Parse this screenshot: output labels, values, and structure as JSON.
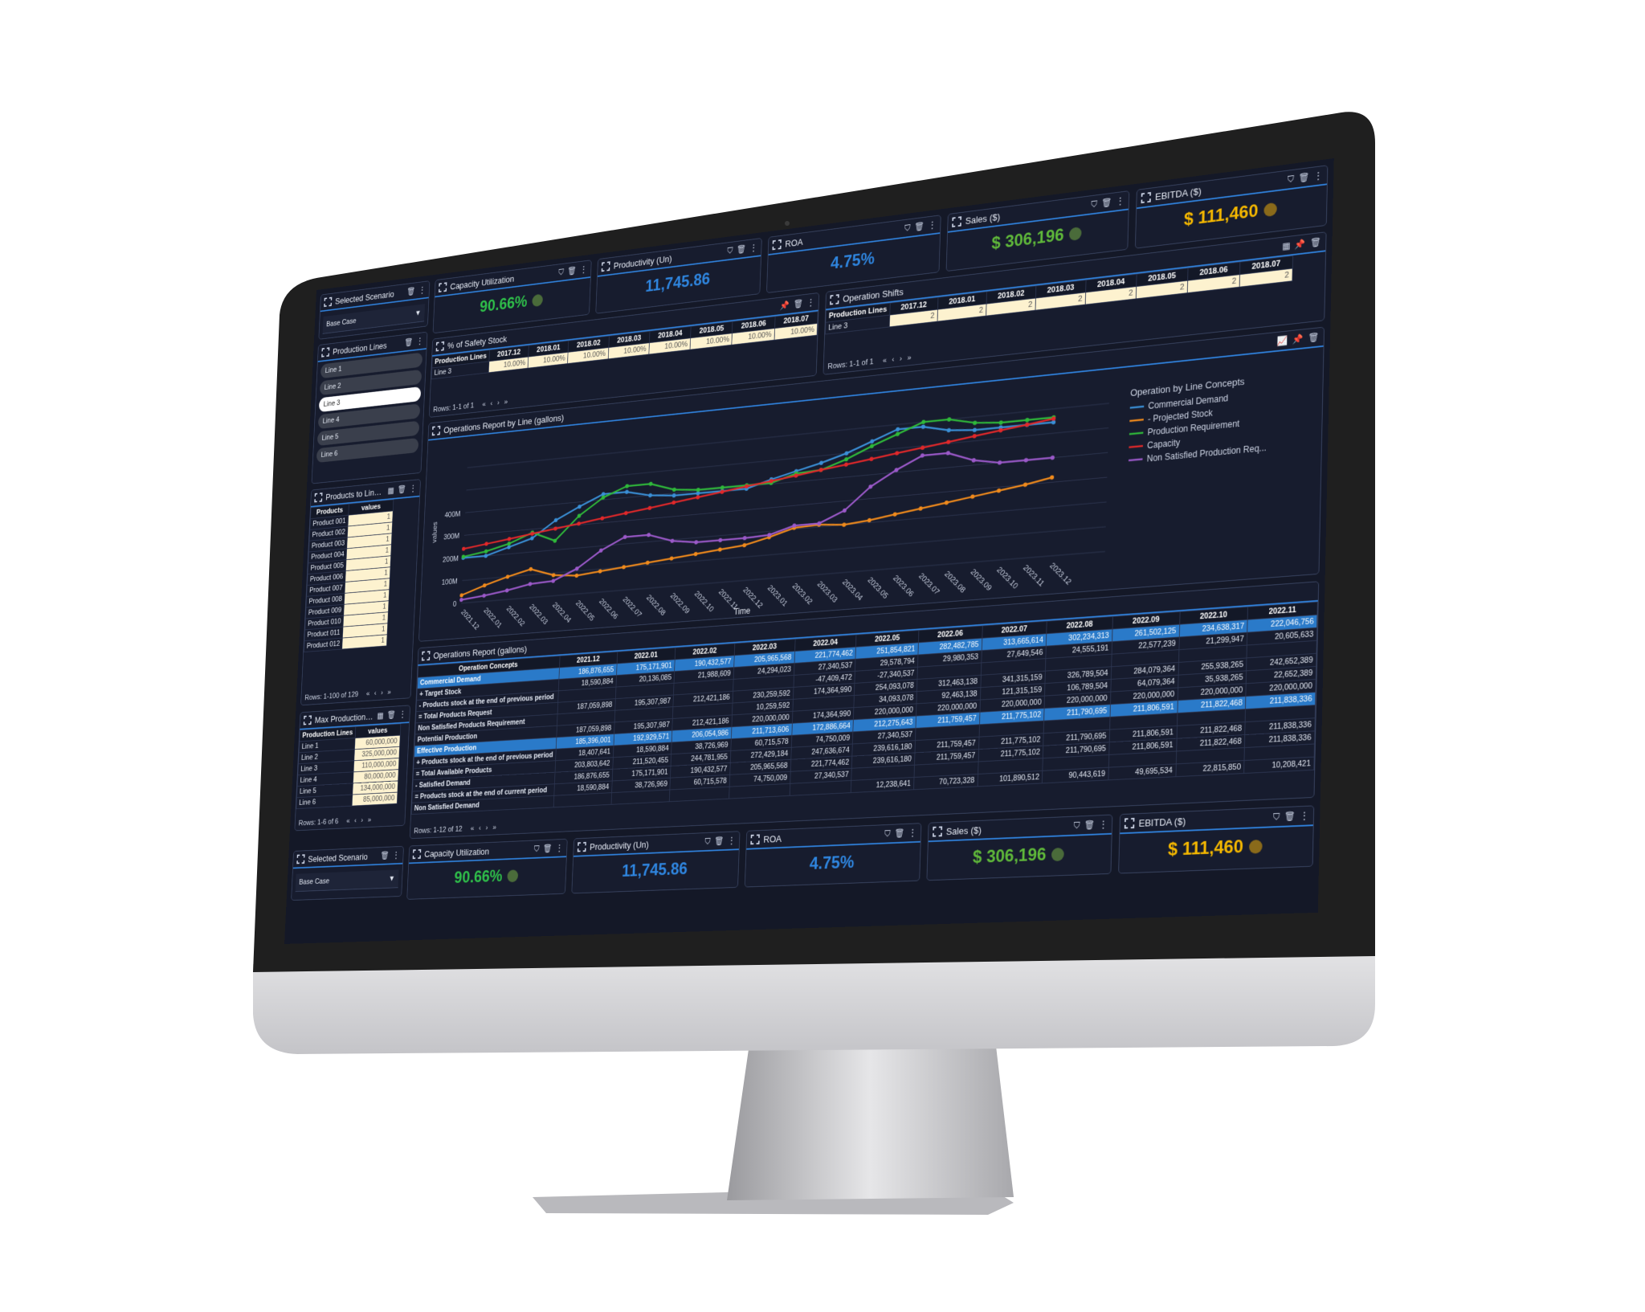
{
  "colors": {
    "accent": "#2f7fd8",
    "green": "#2fbf4a",
    "blue": "#2f86e0",
    "yellow": "#f5b800",
    "dot_green": "#4a6b3a",
    "dot_gold": "#8a6a1a"
  },
  "pagination": {
    "first": "«",
    "prev": "‹",
    "next": "›",
    "last": "»"
  },
  "scenario": {
    "title": "Selected Scenario",
    "value": "Base Case"
  },
  "production_lines": {
    "title": "Production Lines",
    "items": [
      "Line 1",
      "Line 2",
      "Line 3",
      "Line 4",
      "Line 5",
      "Line 6"
    ],
    "selected": "Line 3"
  },
  "products_to_line": {
    "title": "Products to Line...",
    "headers": [
      "Products",
      "values"
    ],
    "rows": [
      [
        "Product 001",
        "1"
      ],
      [
        "Product 002",
        "1"
      ],
      [
        "Product 003",
        "1"
      ],
      [
        "Product 004",
        "1"
      ],
      [
        "Product 005",
        "1"
      ],
      [
        "Product 006",
        "1"
      ],
      [
        "Product 007",
        "1"
      ],
      [
        "Product 008",
        "1"
      ],
      [
        "Product 009",
        "1"
      ],
      [
        "Product 010",
        "1"
      ],
      [
        "Product 011",
        "1"
      ],
      [
        "Product 012",
        "1"
      ]
    ],
    "footer": "Rows: 1-100 of 129"
  },
  "max_production": {
    "title": "Max Production ...",
    "headers": [
      "Production Lines",
      "values"
    ],
    "rows": [
      [
        "Line 1",
        "60,000,000"
      ],
      [
        "Line 2",
        "325,000,000"
      ],
      [
        "Line 3",
        "110,000,000"
      ],
      [
        "Line 4",
        "80,000,000"
      ],
      [
        "Line 5",
        "134,000,000"
      ],
      [
        "Line 6",
        "85,000,000"
      ]
    ],
    "footer": "Rows: 1-6 of 6"
  },
  "kpis": [
    {
      "title": "Capacity Utilization",
      "value": "90.66%",
      "color": "#2fbf4a",
      "dot": "#4a6b3a"
    },
    {
      "title": "Productivity (Un)",
      "value": "11,745.86",
      "color": "#2f86e0",
      "dot": ""
    },
    {
      "title": "ROA",
      "value": "4.75%",
      "color": "#2f86e0",
      "dot": ""
    },
    {
      "title": "Sales ($)",
      "value": "$ 306,196",
      "color": "#5fb83a",
      "dot": "#4a6b3a"
    },
    {
      "title": "EBITDA ($)",
      "value": "$ 111,460",
      "color": "#f5b800",
      "dot": "#8a6a1a"
    }
  ],
  "safety_stock": {
    "title": "% of Safety Stock",
    "row_header": "Production Lines",
    "columns": [
      "2017.12",
      "2018.01",
      "2018.02",
      "2018.03",
      "2018.04",
      "2018.05",
      "2018.06",
      "2018.07"
    ],
    "row_label": "Line 3",
    "values": [
      "10.00%",
      "10.00%",
      "10.00%",
      "10.00%",
      "10.00%",
      "10.00%",
      "10.00%",
      "10.00%"
    ],
    "footer": "Rows: 1-1 of 1"
  },
  "operation_shifts": {
    "title": "Operation Shifts",
    "row_header": "Production Lines",
    "columns": [
      "2017.12",
      "2018.01",
      "2018.02",
      "2018.03",
      "2018.04",
      "2018.05",
      "2018.06",
      "2018.07"
    ],
    "row_label": "Line 3",
    "values": [
      "2",
      "2",
      "2",
      "2",
      "2",
      "2",
      "2",
      "2"
    ],
    "footer": "Rows: 1-1 of 1"
  },
  "chart_data": {
    "type": "line",
    "title": "Operations Report by Line (gallons)",
    "xlabel": "Time",
    "ylabel": "values",
    "ylim": [
      0,
      650
    ],
    "yticks": [
      {
        "v": 0,
        "label": "0"
      },
      {
        "v": 100,
        "label": "100M"
      },
      {
        "v": 200,
        "label": "200M"
      },
      {
        "v": 300,
        "label": "300M"
      },
      {
        "v": 400,
        "label": "400M"
      }
    ],
    "grid": true,
    "legend": {
      "title": "Operation by Line Concepts",
      "position": "right"
    },
    "x": [
      "2021.12",
      "2022.01",
      "2022.02",
      "2022.03",
      "2022.04",
      "2022.05",
      "2022.06",
      "2022.07",
      "2022.08",
      "2022.09",
      "2022.10",
      "2022.11",
      "2022.12",
      "2023.01",
      "2023.02",
      "2023.03",
      "2023.04",
      "2023.05",
      "2023.06",
      "2023.07",
      "2023.08",
      "2023.09",
      "2023.10",
      "2023.11",
      "2023.12"
    ],
    "series": [
      {
        "name": "Commercial Demand",
        "color": "#3a8fd6",
        "values": [
          200,
          200,
          230,
          260,
          330,
          380,
          425,
          425,
          400,
          390,
          390,
          390,
          390,
          420,
          445,
          470,
          500,
          540,
          580,
          580,
          555,
          545,
          545,
          545,
          545
        ]
      },
      {
        "name": "- Projected Stock",
        "color": "#f08a1c",
        "values": [
          35,
          70,
          100,
          125,
          90,
          80,
          90,
          100,
          110,
          120,
          130,
          140,
          150,
          175,
          205,
          210,
          200,
          210,
          225,
          240,
          255,
          270,
          285,
          300,
          320
        ]
      },
      {
        "name": "Production Requirement",
        "color": "#2fb83a",
        "values": [
          205,
          220,
          245,
          285,
          240,
          340,
          410,
          450,
          450,
          415,
          405,
          405,
          405,
          405,
          435,
          440,
          475,
          520,
          560,
          600,
          600,
          575,
          565,
          565,
          565
        ]
      },
      {
        "name": "Capacity",
        "color": "#e0282a",
        "values": [
          240,
          253,
          266,
          280,
          293,
          306,
          320,
          333,
          346,
          360,
          373,
          386,
          400,
          413,
          426,
          440,
          453,
          466,
          480,
          493,
          506,
          520,
          533,
          546,
          560
        ]
      },
      {
        "name": "Non Satisfied Production Req...",
        "color": "#9b59c9",
        "values": [
          15,
          25,
          40,
          60,
          65,
          110,
          180,
          230,
          230,
          195,
          180,
          180,
          180,
          185,
          215,
          215,
          260,
          350,
          410,
          460,
          460,
          420,
          400,
          400,
          400
        ]
      }
    ]
  },
  "ops_table": {
    "title": "Operations Report (gallons)",
    "corner": "Operation Concepts",
    "columns": [
      "2021.12",
      "2022.01",
      "2022.02",
      "2022.03",
      "2022.04",
      "2022.05",
      "2022.06",
      "2022.07",
      "2022.08",
      "2022.09",
      "2022.10",
      "2022.11"
    ],
    "rows": [
      {
        "label": "Commercial Demand",
        "hl": true,
        "values": [
          "186,876,655",
          "175,171,901",
          "190,432,577",
          "205,965,568",
          "221,774,462",
          "251,854,821",
          "282,482,785",
          "313,665,614",
          "302,234,313",
          "261,502,125",
          "234,638,317",
          "222,046,756"
        ]
      },
      {
        "label": "+ Target Stock",
        "hl": false,
        "values": [
          "18,590,884",
          "20,136,085",
          "21,988,609",
          "24,294,023",
          "27,340,537",
          "29,578,794",
          "29,980,353",
          "27,649,546",
          "24,555,191",
          "22,577,239",
          "21,299,947",
          "20,605,633"
        ]
      },
      {
        "label": "- Products stock at the end of previous period",
        "hl": false,
        "values": [
          "",
          "",
          "",
          "",
          "-47,409,472",
          "-27,340,537",
          "",
          "",
          "",
          "",
          "",
          ""
        ]
      },
      {
        "label": "= Total Products Request",
        "hl": false,
        "values": [
          "187,059,898",
          "195,307,987",
          "212,421,186",
          "230,259,592",
          "174,364,990",
          "254,093,078",
          "312,463,138",
          "341,315,159",
          "326,789,504",
          "284,079,364",
          "255,938,265",
          "242,652,389"
        ]
      },
      {
        "label": "Non Satisfied Products Requirement",
        "hl": false,
        "values": [
          "",
          "",
          "",
          "10,259,592",
          "",
          "34,093,078",
          "92,463,138",
          "121,315,159",
          "106,789,504",
          "64,079,364",
          "35,938,265",
          "22,652,389"
        ]
      },
      {
        "label": "Potential Production",
        "hl": false,
        "values": [
          "187,059,898",
          "195,307,987",
          "212,421,186",
          "220,000,000",
          "174,364,990",
          "220,000,000",
          "220,000,000",
          "220,000,000",
          "220,000,000",
          "220,000,000",
          "220,000,000",
          "220,000,000"
        ]
      },
      {
        "label": "Effective Production",
        "hl": true,
        "values": [
          "185,396,001",
          "192,929,571",
          "206,054,986",
          "211,713,606",
          "172,886,664",
          "212,275,643",
          "211,759,457",
          "211,775,102",
          "211,790,695",
          "211,806,591",
          "211,822,468",
          "211,838,336"
        ]
      },
      {
        "label": "+ Products stock at the end of previous period",
        "hl": false,
        "values": [
          "18,407,641",
          "18,590,884",
          "38,726,969",
          "60,715,578",
          "74,750,009",
          "27,340,537",
          "",
          "",
          "",
          "",
          "",
          ""
        ]
      },
      {
        "label": "= Total Available Products",
        "hl": false,
        "values": [
          "203,803,642",
          "211,520,455",
          "244,781,955",
          "272,429,184",
          "247,636,674",
          "239,616,180",
          "211,759,457",
          "211,775,102",
          "211,790,695",
          "211,806,591",
          "211,822,468",
          "211,838,336"
        ]
      },
      {
        "label": "- Satisfied Demand",
        "hl": false,
        "values": [
          "186,876,655",
          "175,171,901",
          "190,432,577",
          "205,965,568",
          "221,774,462",
          "239,616,180",
          "211,759,457",
          "211,775,102",
          "211,790,695",
          "211,806,591",
          "211,822,468",
          "211,838,336"
        ]
      },
      {
        "label": "= Products stock at the end of current period",
        "hl": false,
        "values": [
          "18,590,884",
          "38,726,969",
          "60,715,578",
          "74,750,009",
          "27,340,537",
          "",
          "",
          "",
          "",
          "",
          "",
          ""
        ]
      },
      {
        "label": "Non Satisfied Demand",
        "hl": false,
        "values": [
          "",
          "",
          "",
          "",
          "",
          "12,238,641",
          "70,723,328",
          "101,890,512",
          "90,443,619",
          "49,695,534",
          "22,815,850",
          "10,208,421"
        ]
      }
    ],
    "footer": "Rows: 1-12 of 12"
  }
}
